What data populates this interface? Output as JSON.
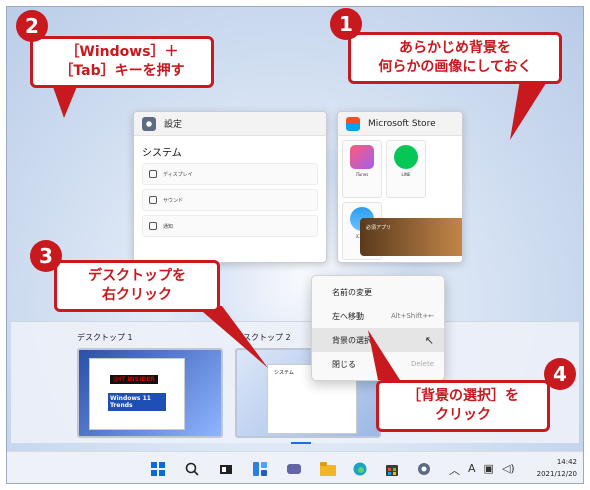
{
  "settings_window": {
    "title": "設定",
    "header": "システム",
    "rows": [
      "ディスプレイ",
      "サウンド",
      "通知"
    ]
  },
  "store_window": {
    "title": "Microsoft Store",
    "apps": [
      "iTunes",
      "LINE",
      "iCloud"
    ],
    "banner": "必須アプリ"
  },
  "desktops": [
    {
      "label": "デスクトップ 1"
    },
    {
      "label": "デスクトップ 2"
    }
  ],
  "thumb_text": {
    "brand": "@IT INSIDER",
    "windows": "Windows 11 Trends",
    "mini_header": "システム"
  },
  "context_menu": {
    "items": [
      {
        "label": "名前の変更",
        "hint": ""
      },
      {
        "label": "左へ移動",
        "hint": "Alt+Shift+←"
      },
      {
        "label": "背景の選択",
        "hint": ""
      },
      {
        "label": "閉じる",
        "hint": "Delete"
      }
    ]
  },
  "taskbar": {
    "icons": [
      "start-icon",
      "search-icon",
      "taskview-icon",
      "widgets-icon",
      "chat-icon",
      "explorer-icon",
      "edge-icon",
      "store-icon",
      "settings-icon"
    ],
    "time": "14:42",
    "date": "2021/12/20",
    "ime": "A"
  },
  "callouts": {
    "c1_line1": "あらかじめ背景を",
    "c1_line2": "何らかの画像にしておく",
    "c2_line1": "［Windows］＋",
    "c2_line2": "［Tab］キーを押す",
    "c3_line1": "デスクトップを",
    "c3_line2": "右クリック",
    "c4_line1": "［背景の選択］を",
    "c4_line2": "クリック"
  },
  "badges": [
    "1",
    "2",
    "3",
    "4"
  ],
  "colors": {
    "accent": "#c8191e",
    "wallpaper": "#c9d8ee",
    "taskbar": "#eef2f8"
  }
}
